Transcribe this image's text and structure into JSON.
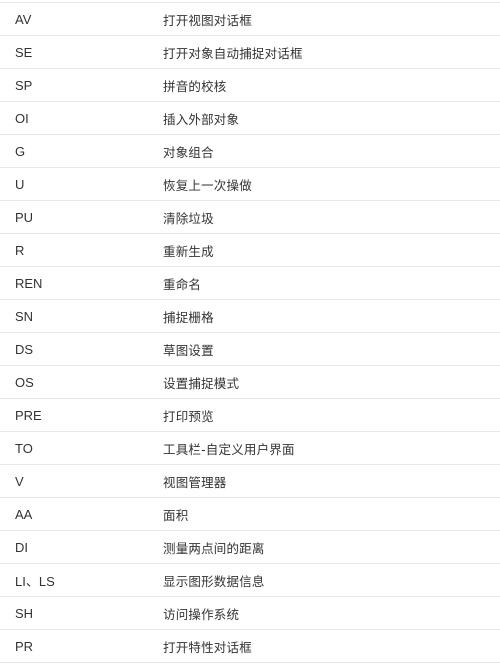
{
  "table": {
    "rows": [
      {
        "command": "AV",
        "description": "打开视图对话框"
      },
      {
        "command": "SE",
        "description": "打开对象自动捕捉对话框"
      },
      {
        "command": "SP",
        "description": "拼音的校核"
      },
      {
        "command": "OI",
        "description": "插入外部对象"
      },
      {
        "command": "G",
        "description": "对象组合"
      },
      {
        "command": "U",
        "description": "恢复上一次操做"
      },
      {
        "command": "PU",
        "description": "清除垃圾"
      },
      {
        "command": "R",
        "description": "重新生成"
      },
      {
        "command": "REN",
        "description": "重命名"
      },
      {
        "command": "SN",
        "description": "捕捉栅格"
      },
      {
        "command": "DS",
        "description": "草图设置"
      },
      {
        "command": "OS",
        "description": "设置捕捉模式"
      },
      {
        "command": "PRE",
        "description": "打印预览"
      },
      {
        "command": "TO",
        "description": "工具栏-自定义用户界面"
      },
      {
        "command": "V",
        "description": "视图管理器"
      },
      {
        "command": "AA",
        "description": "面积"
      },
      {
        "command": "DI",
        "description": "测量两点间的距离"
      },
      {
        "command": "LI、LS",
        "description": "显示图形数据信息"
      },
      {
        "command": "SH",
        "description": "访问操作系统"
      },
      {
        "command": "PR",
        "description": "打开特性对话框"
      }
    ]
  }
}
